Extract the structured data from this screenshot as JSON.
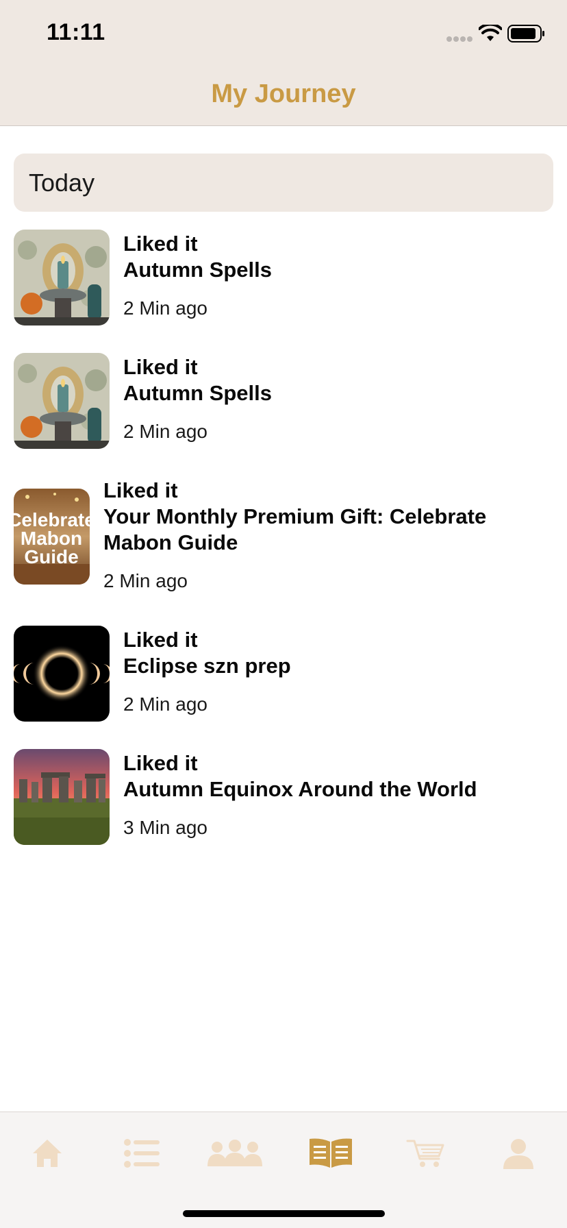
{
  "status_bar": {
    "time": "11:11"
  },
  "nav": {
    "title": "My Journey"
  },
  "section": {
    "title": "Today"
  },
  "items": [
    {
      "action": "Liked it",
      "title": "Autumn Spells",
      "time": "2 Min ago",
      "thumbnail": "autumn-spells-candle-image"
    },
    {
      "action": "Liked it",
      "title": "Autumn Spells",
      "time": "2 Min ago",
      "thumbnail": "autumn-spells-candle-image"
    },
    {
      "action": "Liked it",
      "title": "Your Monthly Premium Gift: Celebrate Mabon Guide",
      "time": "2 Min ago",
      "thumbnail": "celebrate-mabon-guide-image",
      "thumbnail_text": "Celebrate Mabon Guide"
    },
    {
      "action": "Liked it",
      "title": "Eclipse szn prep",
      "time": "2 Min ago",
      "thumbnail": "eclipse-image"
    },
    {
      "action": "Liked it",
      "title": "Autumn Equinox Around the World",
      "time": "3 Min ago",
      "thumbnail": "stonehenge-image"
    }
  ],
  "tab_bar": {
    "tabs": [
      {
        "name": "home",
        "icon": "home-icon",
        "active": false
      },
      {
        "name": "list",
        "icon": "list-icon",
        "active": false
      },
      {
        "name": "community",
        "icon": "community-icon",
        "active": false
      },
      {
        "name": "journal",
        "icon": "book-icon",
        "active": true
      },
      {
        "name": "cart",
        "icon": "cart-icon",
        "active": false
      },
      {
        "name": "profile",
        "icon": "profile-icon",
        "active": false
      }
    ]
  },
  "colors": {
    "accent": "#c99a44",
    "header_bg": "#efe8e2",
    "inactive_tab": "#f0dcc4"
  }
}
